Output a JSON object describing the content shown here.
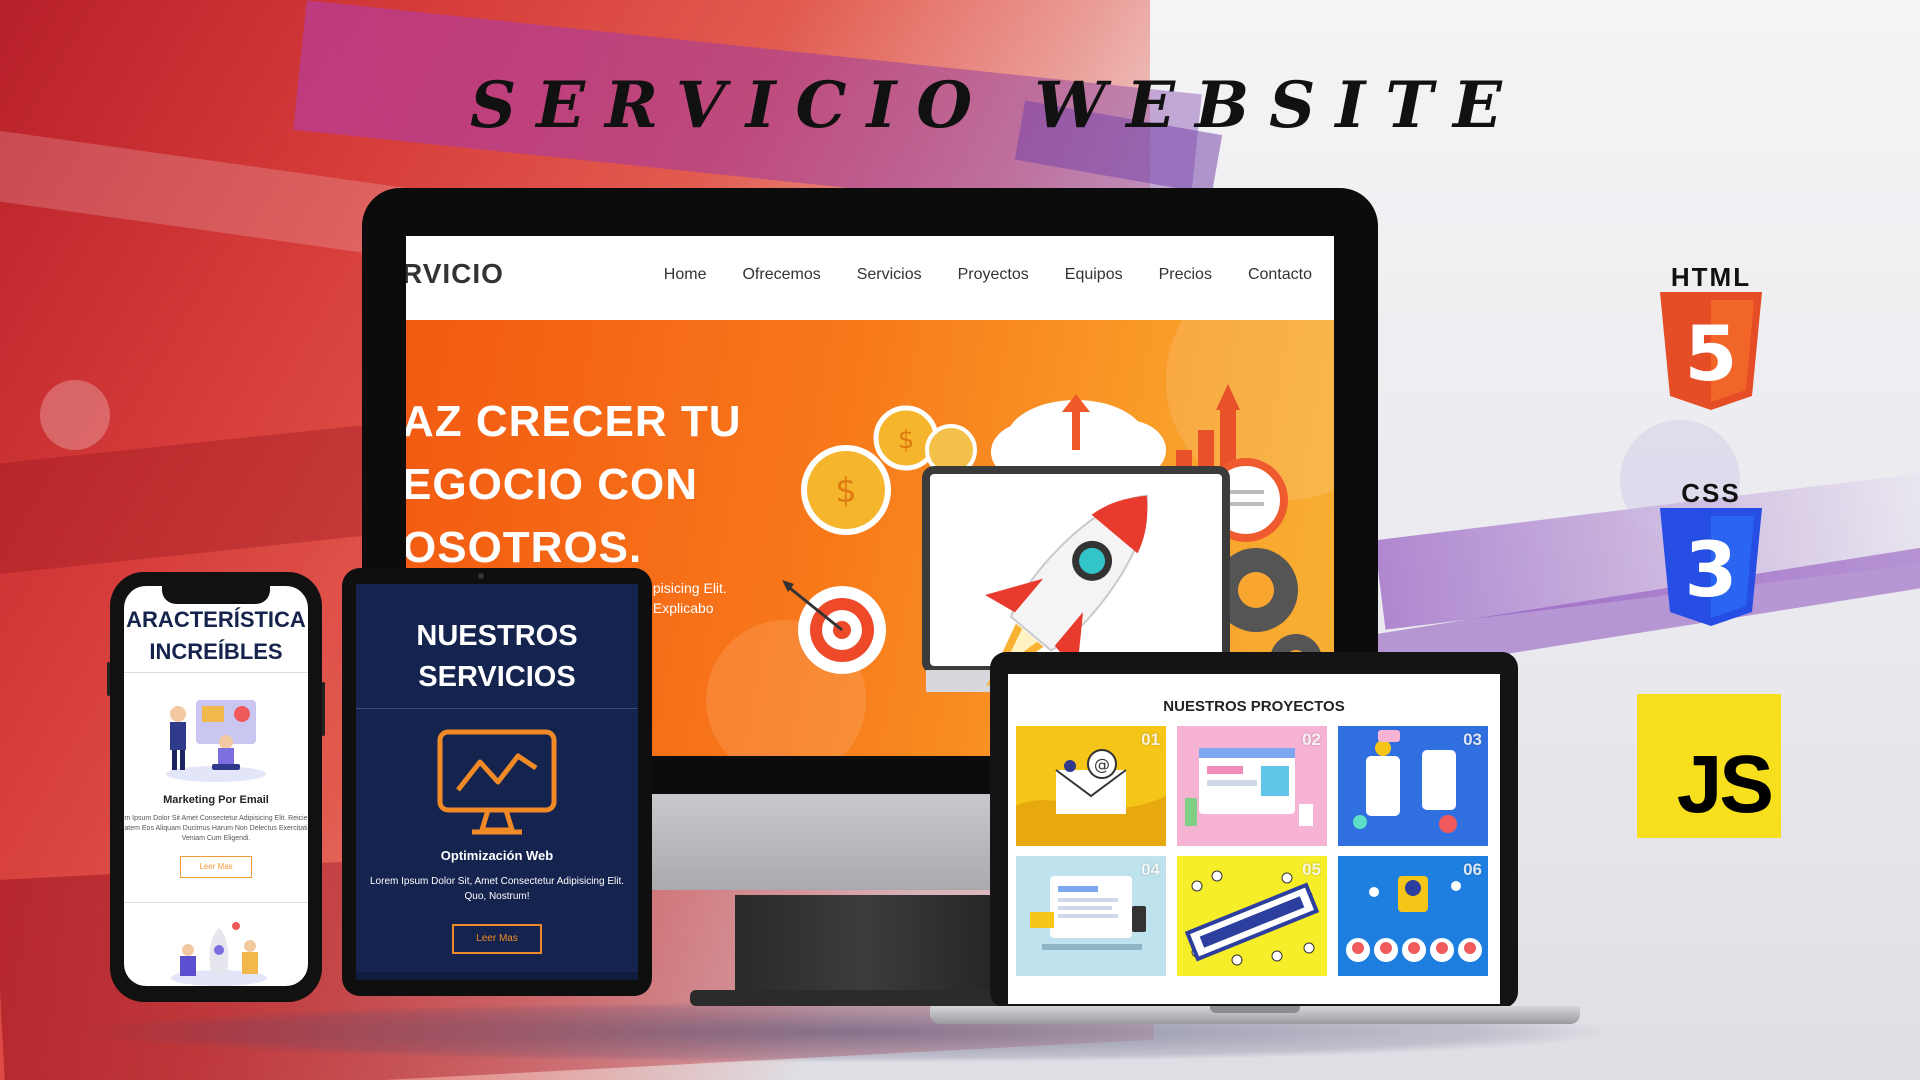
{
  "title": "SERVICIO WEBSITE",
  "desktop": {
    "logo": "RVICIO",
    "nav": [
      "Home",
      "Ofrecemos",
      "Servicios",
      "Proyectos",
      "Equipos",
      "Precios",
      "Contacto"
    ],
    "hero_lines": [
      "AZ CRECER TU",
      "EGOCIO CON",
      "OSOTROS."
    ],
    "hero_sub_lines": [
      "dipisicing Elit.",
      "s Explicabo"
    ],
    "colors": {
      "hero_start": "#f25a12",
      "hero_end": "#f7b134"
    }
  },
  "phone": {
    "section_title_lines": [
      "ARACTERÍSTICA",
      "INCREÍBLES"
    ],
    "card_title": "Marketing Por Email",
    "card_text": "m Ipsum Dolor Sit Amet Consectetur Adipisicing Elit. Reicie atem Eos Aliquam Ducimus Harum Non Delectus Exercitati Veniam Cum Eligendi.",
    "button_label": "Leer Mas"
  },
  "tablet": {
    "section_title_lines": [
      "NUESTROS",
      "SERVICIOS"
    ],
    "card_title": "Optimización Web",
    "card_text": "Lorem Ipsum Dolor Sit, Amet Consectetur Adipisicing Elit. Quo, Nostrum!",
    "button_label": "Leer Mas",
    "icon": "monitor-chart-icon"
  },
  "laptop": {
    "section_title": "NUESTROS PROYECTOS",
    "projects": [
      {
        "num": "01",
        "bg": "#f5c518",
        "icon": "email-envelope-icon"
      },
      {
        "num": "02",
        "bg": "#f6b3d3",
        "icon": "web-design-icon"
      },
      {
        "num": "03",
        "bg": "#2f6fe0",
        "icon": "mobile-social-icon"
      },
      {
        "num": "04",
        "bg": "#bfe3ee",
        "icon": "content-writing-icon"
      },
      {
        "num": "05",
        "bg": "#f7ee2a",
        "icon": "market-crowd-icon"
      },
      {
        "num": "06",
        "bg": "#1e7fe0",
        "icon": "team-network-icon"
      }
    ]
  },
  "tech_logos": {
    "html": {
      "label": "HTML",
      "number": "5",
      "color": "#e44d26"
    },
    "css": {
      "label": "CSS",
      "number": "3",
      "color": "#264de4"
    },
    "js": {
      "label": "JS",
      "color": "#f7df1e"
    }
  }
}
